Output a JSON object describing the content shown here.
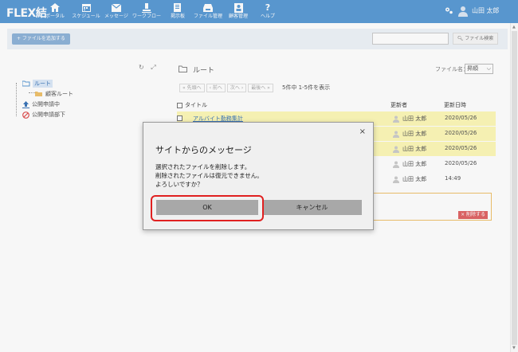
{
  "header": {
    "logo": "FLEX結",
    "nav": [
      {
        "label": "ポータル",
        "icon": "home-icon"
      },
      {
        "label": "スケジュール",
        "icon": "calendar-icon"
      },
      {
        "label": "メッセージ",
        "icon": "message-icon"
      },
      {
        "label": "ワークフロー",
        "icon": "workflow-icon"
      },
      {
        "label": "掲示板",
        "icon": "bulletin-icon"
      },
      {
        "label": "ファイル管理",
        "icon": "file-cabinet-icon"
      },
      {
        "label": "顧客管理",
        "icon": "customer-icon"
      },
      {
        "label": "ヘルプ",
        "icon": "help-icon"
      }
    ],
    "user_name": "山田 太郎"
  },
  "toolbar": {
    "add_file_label": "+ ファイルを追加する",
    "search_value": "",
    "search_button_label": "ファイル検索"
  },
  "tree": {
    "items": [
      {
        "label": "ルート",
        "icon": "folder-open-icon"
      },
      {
        "label": "顧客ルート",
        "icon": "folder-icon"
      },
      {
        "label": "公開申請中",
        "icon": "upload-icon"
      },
      {
        "label": "公開申請部下",
        "icon": "prohibited-icon"
      }
    ]
  },
  "main": {
    "folder_title": "ルート",
    "sort_label": "ファイル名：",
    "sort_value": "昇順",
    "pager": [
      "« 先頭へ",
      "‹ 前へ",
      "次へ ›",
      "最後へ »"
    ],
    "count_text": "5件中 1-5件を表示",
    "columns": {
      "title": "タイトル",
      "updater": "更新者",
      "updated": "更新日時"
    },
    "rows": [
      {
        "name": "アルバイト勤務集計",
        "user": "山田 太郎",
        "date": "2020/05/26",
        "highlighted": true
      },
      {
        "name": "",
        "user": "山田 太郎",
        "date": "2020/05/26",
        "highlighted": true
      },
      {
        "name": "",
        "user": "山田 太郎",
        "date": "2020/05/26",
        "highlighted": true
      },
      {
        "name": "",
        "user": "山田 太郎",
        "date": "2020/05/26",
        "highlighted": false
      },
      {
        "name": "",
        "user": "山田 太郎",
        "date": "14:49",
        "highlighted": false
      }
    ],
    "delete_label": "× 削除する"
  },
  "dialog": {
    "title": "サイトからのメッセージ",
    "lines": [
      "選択されたファイルを削除します。",
      "削除されたファイルは復元できません。",
      "よろしいですか？"
    ],
    "close_label": "×",
    "ok_label": "OK",
    "cancel_label": "キャンセル"
  },
  "colors": {
    "header": "#5b9bd5",
    "highlight_row": "#fdf8b8",
    "callout": "#e02020"
  }
}
